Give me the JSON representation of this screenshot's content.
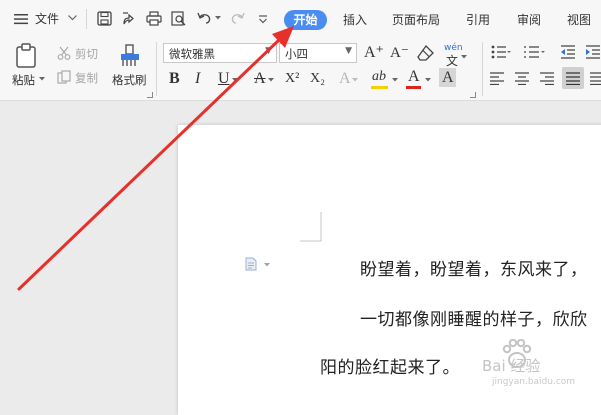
{
  "menu": {
    "file_label": "文件"
  },
  "tabs": [
    {
      "label": "开始",
      "active": true
    },
    {
      "label": "插入",
      "active": false
    },
    {
      "label": "页面布局",
      "active": false
    },
    {
      "label": "引用",
      "active": false
    },
    {
      "label": "审阅",
      "active": false
    },
    {
      "label": "视图",
      "active": false
    }
  ],
  "clipboard": {
    "paste_label": "粘贴",
    "cut_label": "剪切",
    "copy_label": "复制",
    "format_painter_label": "格式刷"
  },
  "font": {
    "font_name": "微软雅黑",
    "font_size": "小四",
    "pinyin_glyph": "wén",
    "bold": "B",
    "italic": "I",
    "underline": "U",
    "strike": "A",
    "superscript": "X²",
    "subscript": "X₂",
    "effect": "A",
    "highlight": "ab",
    "font_color": "A",
    "char_shade": "A",
    "grow": "A⁺",
    "shrink": "A⁻"
  },
  "document": {
    "lines": [
      "盼望着，盼望着，东风来了，",
      "一切都像刚睡醒的样子，欣欣",
      "阳的脸红起来了。"
    ]
  },
  "watermark": {
    "text": "Bai 经验",
    "url": "jingyan.baidu.com"
  },
  "colors": {
    "accent": "#4a8cf0",
    "arrow": "#e8302a",
    "highlight_bar": "#f6d100",
    "font_color_bar": "#d9261c"
  }
}
